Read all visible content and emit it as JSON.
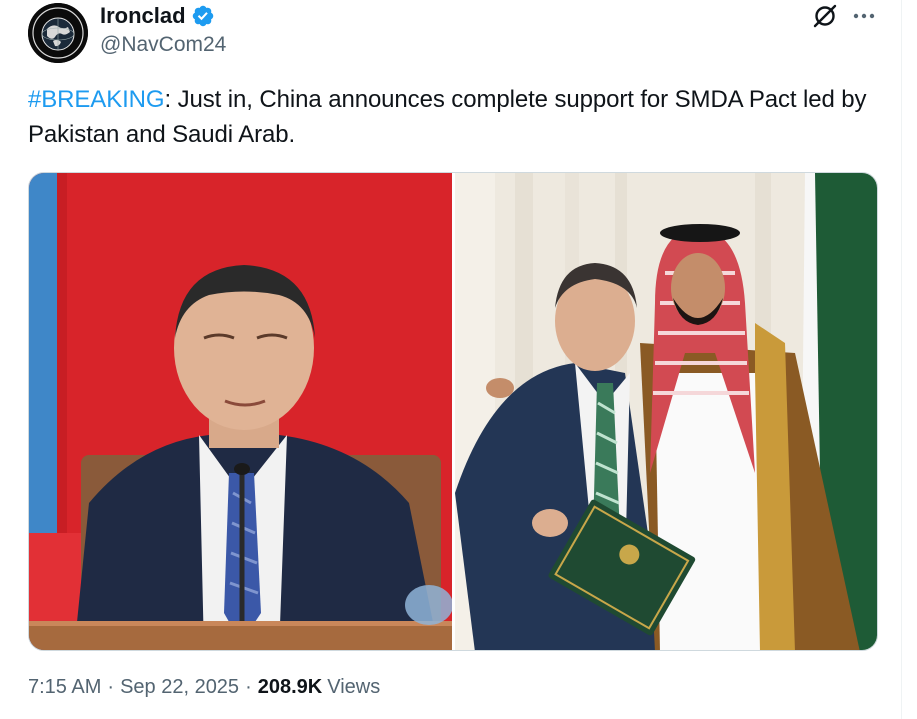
{
  "author": {
    "display_name": "Ironclad",
    "handle": "@NavCom24",
    "verified": true,
    "avatar_icon": "globe-logo-icon"
  },
  "tweet": {
    "hashtag": "#BREAKING",
    "text": ": Just in, China announces complete support for SMDA Pact led by Pakistan and Saudi Arab."
  },
  "media": {
    "images": [
      {
        "description_icon": "photo-speaker-at-podium"
      },
      {
        "description_icon": "photo-two-leaders-embrace"
      }
    ]
  },
  "meta": {
    "time": "7:15 AM",
    "separator": "·",
    "date": "Sep 22, 2025",
    "views_count": "208.9K",
    "views_label": "Views"
  },
  "colors": {
    "accent": "#1d9bf0",
    "text_primary": "#0f1419",
    "text_secondary": "#536471",
    "border": "#cfd9de"
  }
}
